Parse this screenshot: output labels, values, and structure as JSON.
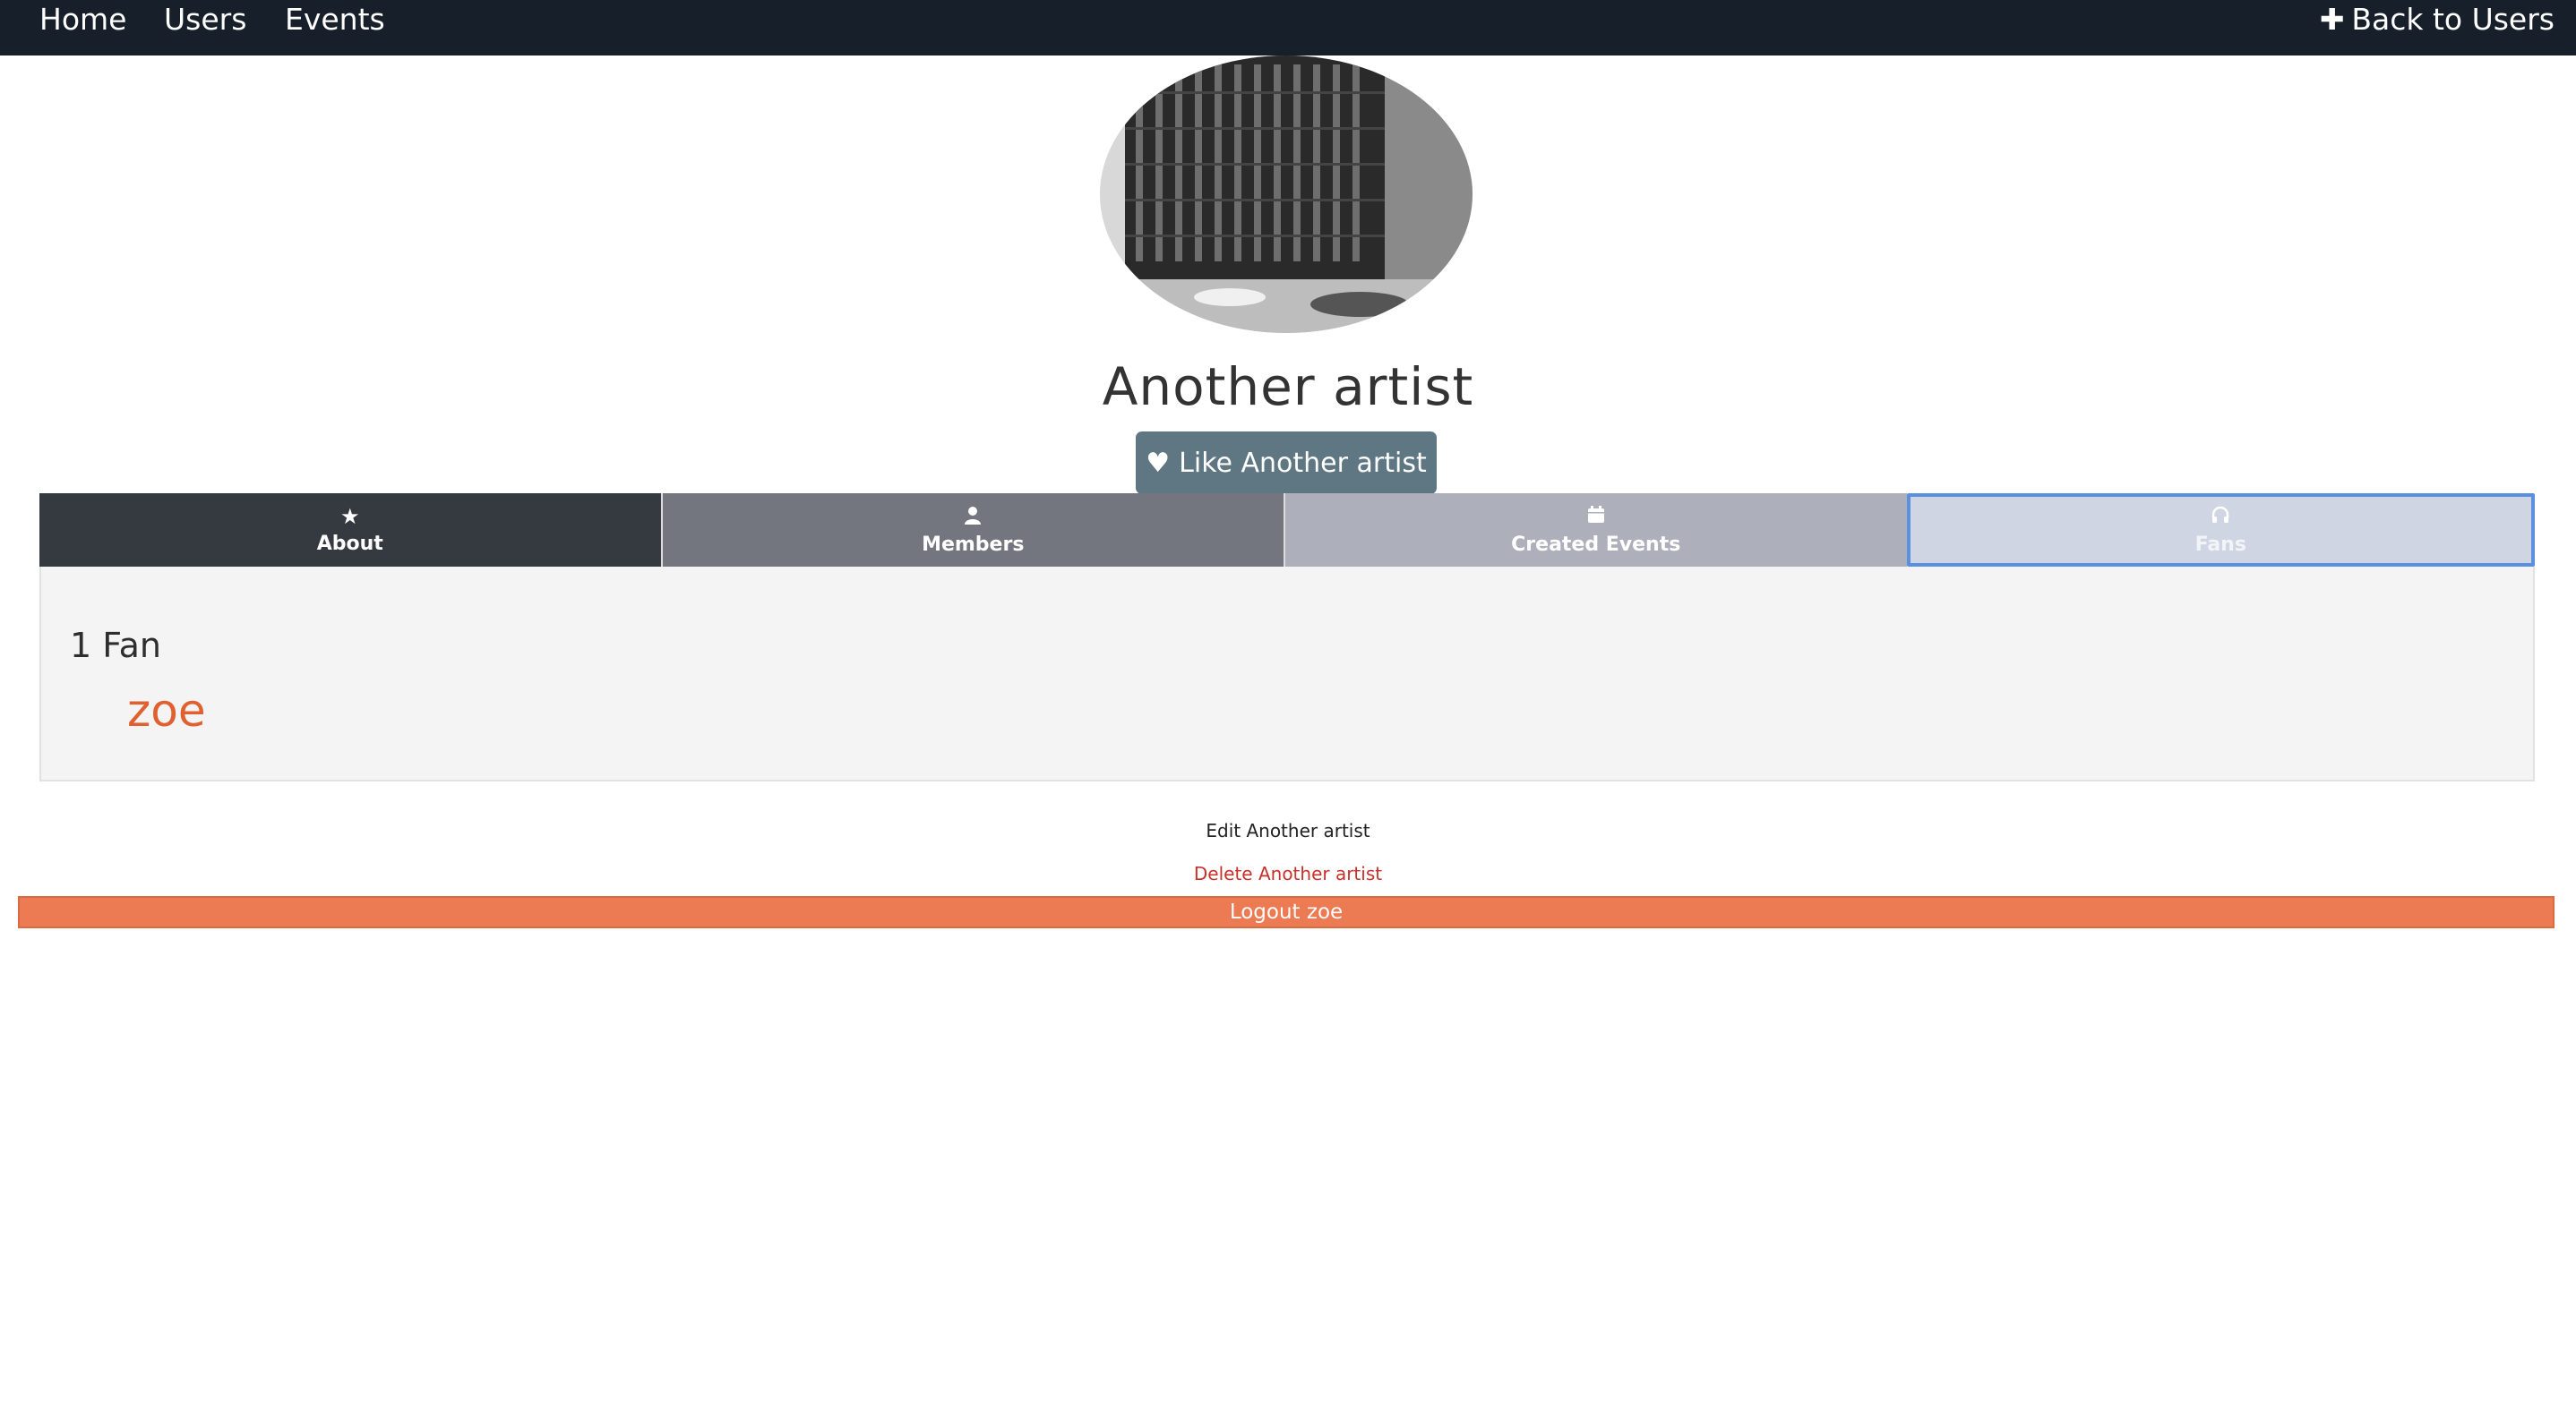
{
  "nav": {
    "home": "Home",
    "users": "Users",
    "events": "Events",
    "back": "Back to Users"
  },
  "profile": {
    "name": "Another artist",
    "like_label": "Like Another artist"
  },
  "tabs": [
    {
      "label": "About",
      "icon": "star-icon"
    },
    {
      "label": "Members",
      "icon": "user-icon"
    },
    {
      "label": "Created Events",
      "icon": "calendar-icon"
    },
    {
      "label": "Fans",
      "icon": "headphones-icon"
    }
  ],
  "fans": {
    "count_label": "1 Fan",
    "list": [
      "zoe"
    ]
  },
  "actions": {
    "edit": "Edit Another artist",
    "delete": "Delete Another artist",
    "logout": "Logout zoe"
  },
  "colors": {
    "navbar": "#17202a",
    "accent": "#ec7a52",
    "fan_link": "#e0602f",
    "like_button": "#5f7683"
  }
}
